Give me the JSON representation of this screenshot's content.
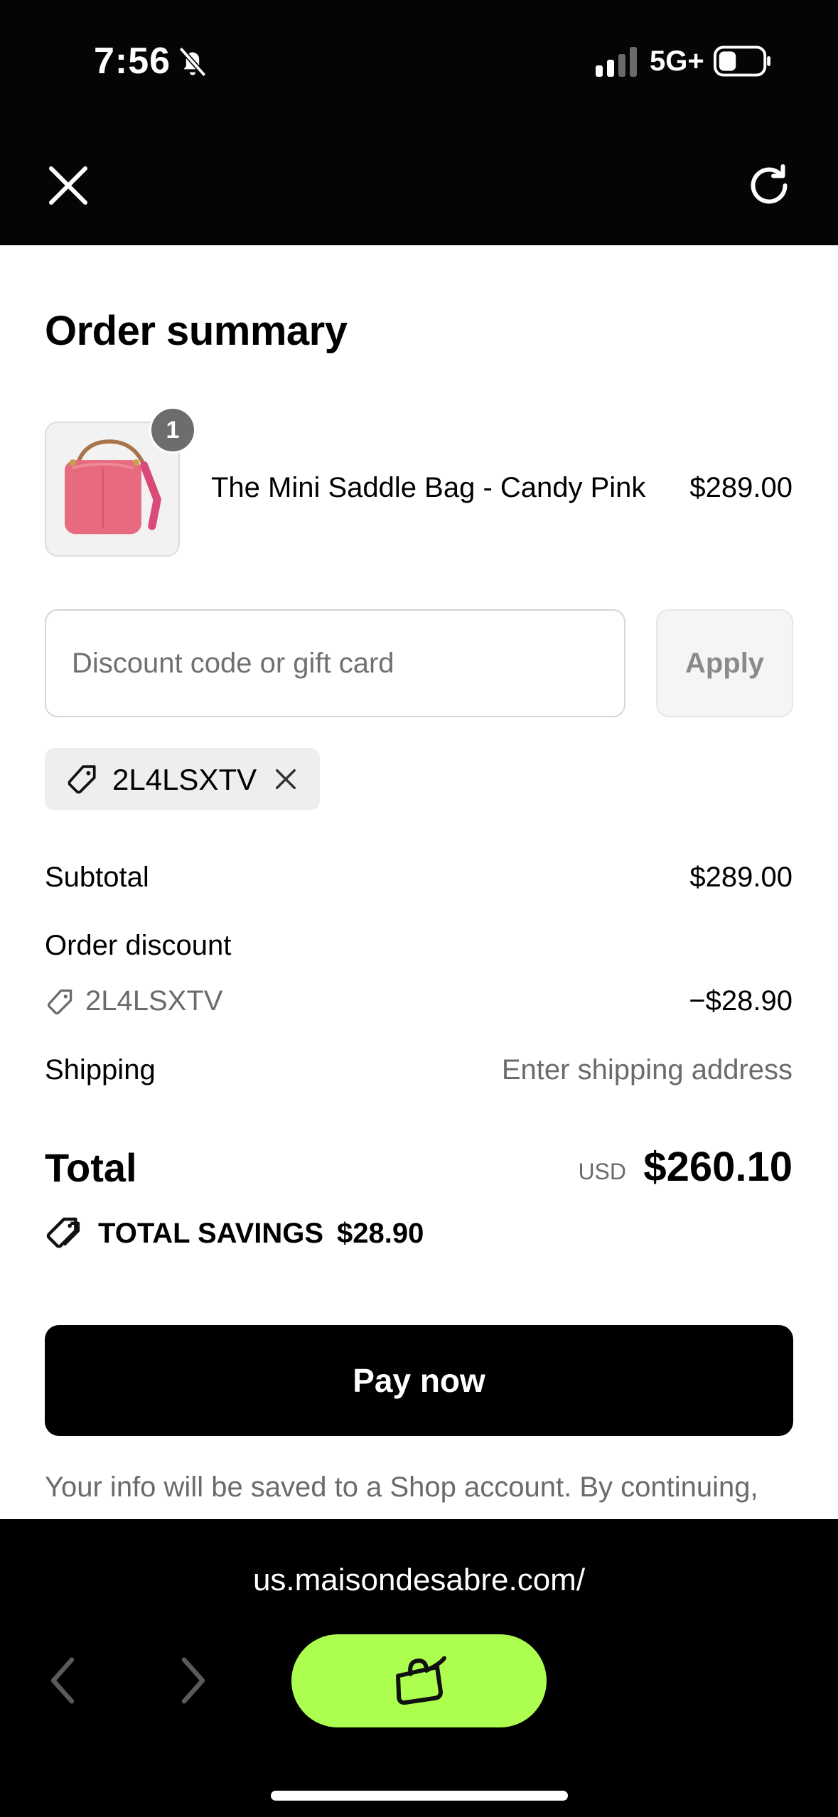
{
  "status_bar": {
    "time": "7:56",
    "network": "5G+",
    "icons": [
      "bell-off-icon",
      "signal-icon",
      "battery-icon"
    ]
  },
  "browser": {
    "url": "us.maisondesabre.com/",
    "shop_button_icon": "shop-bag-icon",
    "accent_color": "#adff4f"
  },
  "order": {
    "title": "Order summary",
    "item": {
      "name": "The Mini Saddle Bag - Candy Pink",
      "price": "$289.00",
      "quantity": "1",
      "bag_color": "#e86a7e"
    },
    "discount": {
      "placeholder": "Discount code or gift card",
      "apply_label": "Apply",
      "applied_code": "2L4LSXTV"
    },
    "summary": {
      "subtotal_label": "Subtotal",
      "subtotal_value": "$289.00",
      "order_discount_label": "Order discount",
      "discount_code": "2L4LSXTV",
      "discount_value": "−$28.90",
      "shipping_label": "Shipping",
      "shipping_value": "Enter shipping address"
    },
    "total": {
      "label": "Total",
      "currency": "USD",
      "value": "$260.10",
      "savings_label": "TOTAL SAVINGS",
      "savings_value": "$28.90"
    },
    "pay_label": "Pay now",
    "info_text": "Your info will be saved to a Shop account. By continuing,"
  }
}
